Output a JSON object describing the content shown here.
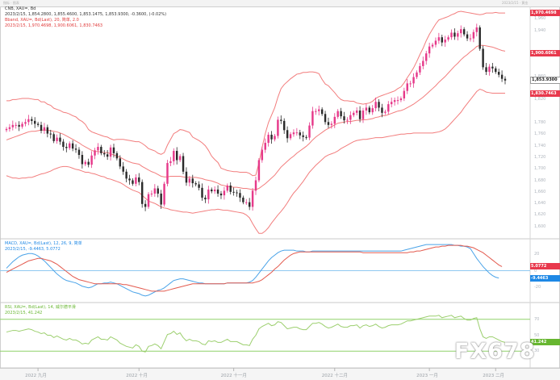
{
  "header": {
    "left": "指标 · 图表",
    "right": "2023/2/15 · 黄金"
  },
  "chart_data": [
    {
      "type": "candlestick",
      "title": "CNB, XAU=, Bd",
      "ohlc_legend": "2023/2/15, 1,854.2800, 1,855.4600, 1,853.1475, 1,853.9300, -0.3600, (-0.02%)",
      "indicator_legend": "Bband, XAU=, Bd(Last), 20, 简单, 2.0",
      "indicator_values": "2023/2/15, 1,970.4698, 1,900.6061, 1,830.7463",
      "yrange": [
        1580,
        1980
      ],
      "ticks": [
        "1,960",
        "1,940",
        "1,900",
        "1,860",
        "1,820",
        "1,780",
        "1,760",
        "1,740",
        "1,720",
        "1,700",
        "1,680",
        "1,660",
        "1,640",
        "1,620",
        "1,600"
      ],
      "tick_values": [
        1960,
        1940,
        1900,
        1860,
        1820,
        1780,
        1760,
        1740,
        1720,
        1700,
        1680,
        1660,
        1640,
        1620,
        1600
      ],
      "price_tags": [
        {
          "label": "1,970.4698",
          "value": 1970.4698,
          "bg": "#e8394d",
          "fg": "#ffffff"
        },
        {
          "label": "1,900.6061",
          "value": 1900.6061,
          "bg": "#e8394d",
          "fg": "#ffffff"
        },
        {
          "label": "1,853.9300",
          "value": 1853.93,
          "bg": "#ffffff",
          "fg": "#222222"
        },
        {
          "label": "1,830.7463",
          "value": 1830.7463,
          "bg": "#e8394d",
          "fg": "#ffffff"
        }
      ],
      "close": [
        1769,
        1772,
        1776,
        1776,
        1773,
        1778,
        1781,
        1786,
        1783,
        1778,
        1776,
        1766,
        1772,
        1761,
        1760,
        1748,
        1754,
        1747,
        1738,
        1736,
        1744,
        1735,
        1733,
        1724,
        1708,
        1712,
        1707,
        1723,
        1732,
        1738,
        1727,
        1725,
        1721,
        1737,
        1727,
        1718,
        1704,
        1695,
        1683,
        1680,
        1674,
        1685,
        1677,
        1639,
        1634,
        1656,
        1657,
        1666,
        1657,
        1638,
        1674,
        1710,
        1713,
        1731,
        1715,
        1722,
        1695,
        1676,
        1683,
        1675,
        1673,
        1667,
        1650,
        1647,
        1664,
        1661,
        1664,
        1657,
        1654,
        1662,
        1671,
        1660,
        1659,
        1658,
        1650,
        1642,
        1642,
        1634,
        1662,
        1680,
        1715,
        1733,
        1745,
        1759,
        1751,
        1757,
        1785,
        1783,
        1767,
        1753,
        1760,
        1763,
        1763,
        1758,
        1755,
        1754,
        1775,
        1800,
        1800,
        1803,
        1795,
        1781,
        1776,
        1778,
        1790,
        1800,
        1791,
        1784,
        1785,
        1793,
        1797,
        1801,
        1786,
        1801,
        1806,
        1798,
        1805,
        1816,
        1806,
        1797,
        1799,
        1812,
        1816,
        1819,
        1819,
        1822,
        1835,
        1848,
        1848,
        1859,
        1867,
        1878,
        1887,
        1900,
        1912,
        1915,
        1922,
        1928,
        1919,
        1924,
        1928,
        1936,
        1929,
        1935,
        1942,
        1933,
        1926,
        1926,
        1937,
        1945,
        1908,
        1876,
        1868,
        1877,
        1874,
        1868,
        1863,
        1856,
        1853
      ],
      "bb_upper": [
        1818,
        1818,
        1820,
        1820,
        1821,
        1822,
        1822,
        1822,
        1821,
        1820,
        1820,
        1816,
        1816,
        1812,
        1810,
        1805,
        1803,
        1801,
        1798,
        1797,
        1795,
        1792,
        1790,
        1785,
        1782,
        1777,
        1768,
        1764,
        1762,
        1760,
        1758,
        1756,
        1755,
        1752,
        1750,
        1751,
        1751,
        1751,
        1750,
        1749,
        1748,
        1747,
        1747,
        1744,
        1740,
        1735,
        1733,
        1731,
        1727,
        1725,
        1728,
        1741,
        1751,
        1761,
        1764,
        1768,
        1767,
        1765,
        1763,
        1755,
        1752,
        1749,
        1745,
        1740,
        1732,
        1722,
        1716,
        1711,
        1701,
        1699,
        1697,
        1696,
        1695,
        1695,
        1694,
        1694,
        1694,
        1692,
        1688,
        1689,
        1710,
        1737,
        1761,
        1780,
        1793,
        1806,
        1824,
        1839,
        1846,
        1851,
        1856,
        1860,
        1864,
        1865,
        1867,
        1867,
        1868,
        1868,
        1867,
        1865,
        1855,
        1847,
        1844,
        1838,
        1832,
        1825,
        1820,
        1818,
        1818,
        1817,
        1817,
        1814,
        1813,
        1812,
        1813,
        1814,
        1817,
        1822,
        1825,
        1827,
        1829,
        1831,
        1833,
        1835,
        1839,
        1842,
        1849,
        1858,
        1866,
        1875,
        1886,
        1898,
        1909,
        1922,
        1933,
        1942,
        1951,
        1958,
        1960,
        1962,
        1964,
        1967,
        1969,
        1972,
        1973,
        1972,
        1971,
        1970,
        1969,
        1968,
        1967,
        1968,
        1970,
        1970,
        1970,
        1971,
        1970,
        1970,
        1970
      ],
      "bb_mid": [
        1750,
        1752,
        1754,
        1756,
        1758,
        1760,
        1762,
        1764,
        1765,
        1765,
        1766,
        1767,
        1767,
        1767,
        1766,
        1765,
        1764,
        1762,
        1760,
        1757,
        1754,
        1751,
        1748,
        1745,
        1741,
        1738,
        1735,
        1732,
        1730,
        1730,
        1729,
        1728,
        1728,
        1726,
        1724,
        1722,
        1720,
        1717,
        1714,
        1712,
        1710,
        1709,
        1708,
        1704,
        1701,
        1698,
        1695,
        1693,
        1690,
        1687,
        1686,
        1686,
        1687,
        1687,
        1687,
        1687,
        1686,
        1685,
        1685,
        1685,
        1685,
        1684,
        1683,
        1681,
        1680,
        1679,
        1677,
        1675,
        1672,
        1671,
        1669,
        1669,
        1668,
        1668,
        1667,
        1666,
        1666,
        1665,
        1664,
        1664,
        1666,
        1670,
        1674,
        1679,
        1684,
        1689,
        1696,
        1703,
        1708,
        1713,
        1718,
        1722,
        1727,
        1731,
        1735,
        1739,
        1744,
        1750,
        1755,
        1759,
        1763,
        1767,
        1770,
        1773,
        1776,
        1779,
        1780,
        1781,
        1782,
        1782,
        1783,
        1784,
        1784,
        1785,
        1785,
        1786,
        1787,
        1789,
        1790,
        1792,
        1792,
        1794,
        1796,
        1798,
        1800,
        1801,
        1803,
        1806,
        1809,
        1812,
        1816,
        1820,
        1824,
        1829,
        1834,
        1839,
        1844,
        1850,
        1855,
        1860,
        1866,
        1872,
        1878,
        1883,
        1889,
        1894,
        1898,
        1903,
        1907,
        1912,
        1914,
        1914,
        1913,
        1912,
        1911,
        1909,
        1907,
        1905,
        1904
      ],
      "bb_lower": [
        1688,
        1686,
        1684,
        1684,
        1683,
        1684,
        1684,
        1685,
        1685,
        1687,
        1689,
        1691,
        1692,
        1694,
        1696,
        1699,
        1701,
        1703,
        1704,
        1704,
        1703,
        1701,
        1699,
        1698,
        1696,
        1694,
        1694,
        1692,
        1691,
        1689,
        1687,
        1686,
        1683,
        1682,
        1680,
        1678,
        1676,
        1673,
        1669,
        1666,
        1663,
        1661,
        1659,
        1654,
        1649,
        1644,
        1642,
        1640,
        1637,
        1634,
        1632,
        1631,
        1629,
        1628,
        1627,
        1626,
        1625,
        1625,
        1624,
        1623,
        1624,
        1625,
        1626,
        1627,
        1628,
        1629,
        1629,
        1630,
        1629,
        1628,
        1628,
        1627,
        1626,
        1625,
        1624,
        1623,
        1620,
        1615,
        1605,
        1596,
        1588,
        1588,
        1592,
        1598,
        1606,
        1613,
        1620,
        1626,
        1633,
        1641,
        1650,
        1658,
        1664,
        1671,
        1678,
        1686,
        1694,
        1700,
        1706,
        1711,
        1716,
        1721,
        1724,
        1726,
        1728,
        1731,
        1735,
        1738,
        1741,
        1744,
        1747,
        1749,
        1750,
        1751,
        1751,
        1752,
        1753,
        1754,
        1754,
        1754,
        1755,
        1756,
        1757,
        1758,
        1759,
        1760,
        1760,
        1761,
        1761,
        1762,
        1762,
        1762,
        1762,
        1762,
        1762,
        1762,
        1763,
        1764,
        1766,
        1769,
        1774,
        1780,
        1786,
        1792,
        1798,
        1806,
        1813,
        1820,
        1827,
        1834,
        1838,
        1836,
        1833,
        1832,
        1831,
        1831,
        1831,
        1831,
        1831
      ]
    },
    {
      "type": "line",
      "title": "MACD, XAU=, Bd(Last), 12, 26, 9, 简单",
      "values_legend": "2023/2/15, -9.4463, 5.0772",
      "yrange": [
        -38,
        38
      ],
      "ticks": [
        "20",
        "0",
        "-20"
      ],
      "tick_values": [
        20,
        0,
        -20
      ],
      "price_tags": [
        {
          "label": "5.0772",
          "value": 5.0772,
          "bg": "#e8394d",
          "fg": "#ffffff"
        },
        {
          "label": "-9.4463",
          "value": -9.4463,
          "bg": "#1e88e5",
          "fg": "#ffffff"
        }
      ],
      "macd": [
        3,
        7,
        11,
        14,
        17,
        19,
        20,
        21,
        21,
        20,
        18,
        15,
        12,
        8,
        4,
        0,
        -4,
        -7,
        -10,
        -12,
        -13,
        -14,
        -15,
        -17,
        -19,
        -20,
        -21,
        -20,
        -18,
        -16,
        -16,
        -15,
        -15,
        -14,
        -15,
        -16,
        -18,
        -20,
        -22,
        -24,
        -26,
        -27,
        -28,
        -30,
        -31,
        -30,
        -28,
        -26,
        -24,
        -23,
        -21,
        -18,
        -15,
        -12,
        -11,
        -10,
        -10,
        -11,
        -12,
        -13,
        -14,
        -15,
        -15,
        -16,
        -16,
        -16,
        -16,
        -16,
        -16,
        -16,
        -15,
        -15,
        -15,
        -15,
        -15,
        -15,
        -15,
        -14,
        -12,
        -8,
        -3,
        2,
        7,
        12,
        16,
        19,
        22,
        24,
        25,
        25,
        25,
        25,
        24,
        24,
        24,
        23,
        23,
        24,
        24,
        24,
        24,
        24,
        24,
        24,
        24,
        24,
        24,
        24,
        24,
        24,
        24,
        24,
        24,
        24,
        24,
        24,
        24,
        24,
        24,
        24,
        24,
        24,
        24,
        24,
        24,
        24,
        25,
        26,
        27,
        28,
        29,
        30,
        31,
        32,
        32,
        32,
        32,
        32,
        32,
        32,
        32,
        32,
        31,
        31,
        30,
        30,
        29,
        27,
        21,
        15,
        10,
        5,
        1,
        -3,
        -6,
        -8,
        -9
      ],
      "signal": [
        -2,
        0,
        2,
        4,
        6,
        8,
        10,
        12,
        13,
        14,
        15,
        15,
        14,
        13,
        12,
        10,
        8,
        5,
        2,
        -1,
        -4,
        -7,
        -9,
        -11,
        -12,
        -13,
        -14,
        -15,
        -16,
        -16,
        -16,
        -16,
        -16,
        -16,
        -16,
        -16,
        -16,
        -17,
        -17,
        -18,
        -19,
        -20,
        -21,
        -22,
        -23,
        -24,
        -25,
        -25,
        -25,
        -25,
        -25,
        -24,
        -23,
        -22,
        -21,
        -20,
        -19,
        -18,
        -17,
        -16,
        -16,
        -16,
        -16,
        -16,
        -16,
        -16,
        -16,
        -16,
        -16,
        -16,
        -15,
        -15,
        -15,
        -15,
        -15,
        -15,
        -15,
        -15,
        -15,
        -14,
        -13,
        -11,
        -8,
        -5,
        -2,
        2,
        5,
        9,
        13,
        16,
        19,
        21,
        22,
        23,
        23,
        23,
        23,
        23,
        23,
        23,
        23,
        23,
        23,
        23,
        23,
        23,
        23,
        23,
        23,
        23,
        23,
        23,
        23,
        22,
        22,
        22,
        22,
        22,
        22,
        22,
        22,
        22,
        22,
        22,
        22,
        22,
        22,
        22,
        23,
        23,
        24,
        24,
        25,
        26,
        27,
        28,
        29,
        29,
        30,
        30,
        31,
        31,
        31,
        31,
        31,
        30,
        30,
        29,
        28,
        26,
        24,
        22,
        19,
        16,
        13,
        10,
        7,
        5
      ]
    },
    {
      "type": "line",
      "title": "RSI, XAU=, Bd(Last), 14, 威尔德平滑",
      "values_legend": "2023/2/15, 41.242",
      "yrange": [
        10,
        90
      ],
      "ticks": [
        "70",
        "50",
        "30"
      ],
      "tick_values": [
        70,
        50,
        30
      ],
      "thresholds": [
        70,
        30
      ],
      "price_tags": [
        {
          "label": "41.242",
          "value": 41.242,
          "bg": "#67b630",
          "fg": "#ffffff"
        }
      ],
      "values": [
        54,
        55,
        56,
        56,
        55,
        56,
        57,
        58,
        57,
        55,
        54,
        52,
        53,
        50,
        50,
        47,
        49,
        47,
        45,
        44,
        46,
        44,
        44,
        42,
        39,
        40,
        39,
        44,
        46,
        48,
        45,
        45,
        44,
        48,
        46,
        44,
        40,
        38,
        36,
        35,
        34,
        38,
        36,
        30,
        29,
        36,
        37,
        39,
        37,
        33,
        42,
        51,
        52,
        55,
        51,
        53,
        47,
        43,
        45,
        43,
        43,
        42,
        39,
        38,
        43,
        42,
        43,
        41,
        41,
        43,
        45,
        42,
        42,
        42,
        40,
        38,
        38,
        37,
        45,
        50,
        58,
        61,
        63,
        65,
        62,
        63,
        67,
        66,
        62,
        58,
        59,
        60,
        60,
        58,
        57,
        57,
        61,
        65,
        65,
        66,
        64,
        61,
        59,
        60,
        62,
        64,
        61,
        60,
        60,
        62,
        62,
        63,
        59,
        62,
        63,
        61,
        62,
        64,
        61,
        59,
        60,
        62,
        63,
        63,
        63,
        64,
        66,
        68,
        68,
        69,
        70,
        71,
        72,
        73,
        74,
        74,
        74,
        75,
        72,
        73,
        74,
        75,
        72,
        73,
        74,
        71,
        69,
        69,
        71,
        72,
        58,
        48,
        46,
        48,
        48,
        46,
        44,
        42,
        41
      ]
    },
    {
      "type": "axis",
      "x_ticks": [
        "2022 九月",
        "2022 十月",
        "2022 十一月",
        "2022 十二月",
        "2023 一月",
        "2023 二月"
      ],
      "x_tick_positions": [
        10,
        42,
        72,
        104,
        134,
        155
      ]
    }
  ],
  "watermark": "FX678"
}
